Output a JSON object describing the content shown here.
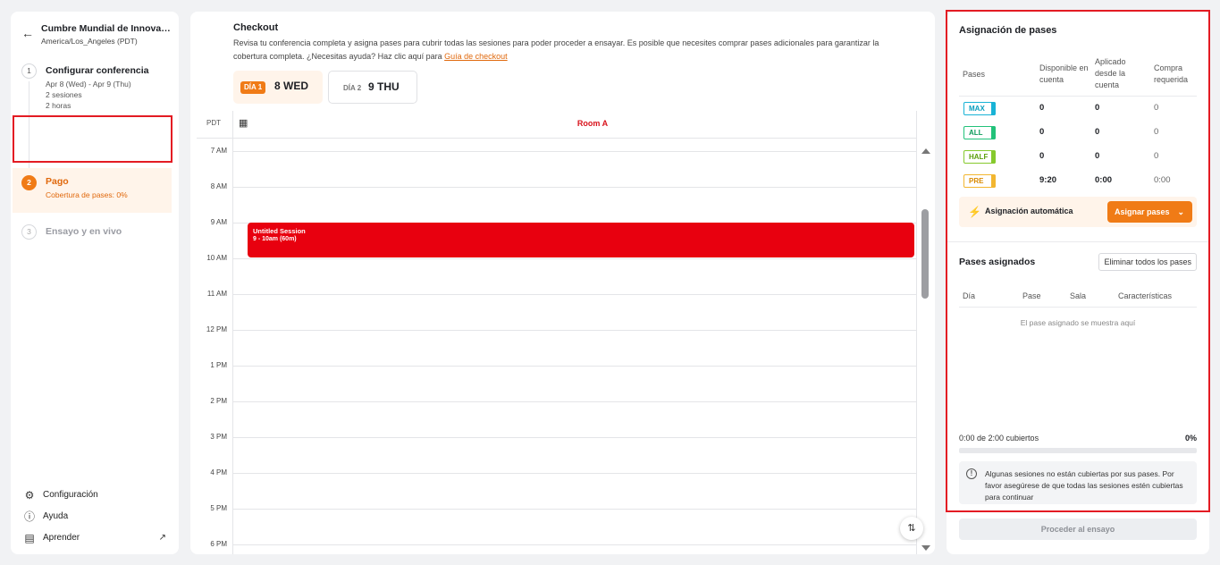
{
  "sidebar": {
    "conference_name": "Cumbre Mundial de Innovaci...",
    "timezone": "America/Los_Angeles (PDT)",
    "steps": [
      {
        "num": "1",
        "title": "Configurar conferencia",
        "meta": [
          "Apr 8 (Wed) - Apr 9 (Thu)",
          "2 sesiones",
          "2 horas"
        ]
      },
      {
        "num": "2",
        "title": "Pago",
        "meta": [
          "Cobertura de pases: 0%"
        ]
      },
      {
        "num": "3",
        "title": "Ensayo y en vivo",
        "meta": []
      }
    ],
    "links": [
      {
        "label": "Configuración",
        "icon": "gear-icon"
      },
      {
        "label": "Ayuda",
        "icon": "help-circle-icon"
      },
      {
        "label": "Aprender",
        "icon": "book-icon"
      }
    ]
  },
  "main": {
    "title": "Checkout",
    "description": "Revisa tu conferencia completa y asigna pases para cubrir todas las sesiones para poder proceder a ensayar. Es posible que necesites comprar pases adicionales para garantizar la cobertura completa. ¿Necesitas ayuda? Haz clic aquí para ",
    "guide_link": "Guía de checkout",
    "days": [
      {
        "badge": "DÍA 1",
        "label": "8 WED",
        "active": true
      },
      {
        "badge": "DÍA 2",
        "label": "9 THU",
        "active": false
      }
    ],
    "calendar": {
      "tz_label": "PDT",
      "room": "Room A",
      "hours": [
        "7 AM",
        "8 AM",
        "9 AM",
        "10 AM",
        "11 AM",
        "12 PM",
        "1 PM",
        "2 PM",
        "3 PM",
        "4 PM",
        "5 PM",
        "6 PM"
      ],
      "session": {
        "title": "Untitled Session",
        "time": "9 - 10am (60m)",
        "color": "#e8000f"
      }
    }
  },
  "right": {
    "title": "Asignación de pases",
    "headers": [
      "Pases",
      "Disponible en cuenta",
      "Aplicado desde la cuenta",
      "Compra requerida"
    ],
    "passes": [
      {
        "tag": "MAX",
        "available": "0",
        "applied": "0",
        "required": "0"
      },
      {
        "tag": "ALL",
        "available": "0",
        "applied": "0",
        "required": "0"
      },
      {
        "tag": "HALF",
        "available": "0",
        "applied": "0",
        "required": "0"
      },
      {
        "tag": "PRE",
        "available": "9:20",
        "applied": "0:00",
        "required": "0:00"
      }
    ],
    "auto_label": "Asignación automática",
    "auto_button": "Asignar pases",
    "assigned_title": "Pases asignados",
    "clear_button": "Eliminar todos los pases",
    "assigned_headers": [
      "Día",
      "Pase",
      "Sala",
      "Características"
    ],
    "empty_message": "El pase asignado se muestra aquí",
    "coverage_text": "0:00 de 2:00 cubiertos",
    "coverage_pct": "0%",
    "coverage_fraction": 0,
    "warning": "Algunas sesiones no están cubiertas por sus pases. Por favor asegúrese de que todas las sesiones estén cubiertas para continuar",
    "proceed_button": "Proceder al ensayo"
  },
  "colors": {
    "accent": "#f07b16",
    "session": "#e8000f",
    "highlight": "#e31b23"
  }
}
